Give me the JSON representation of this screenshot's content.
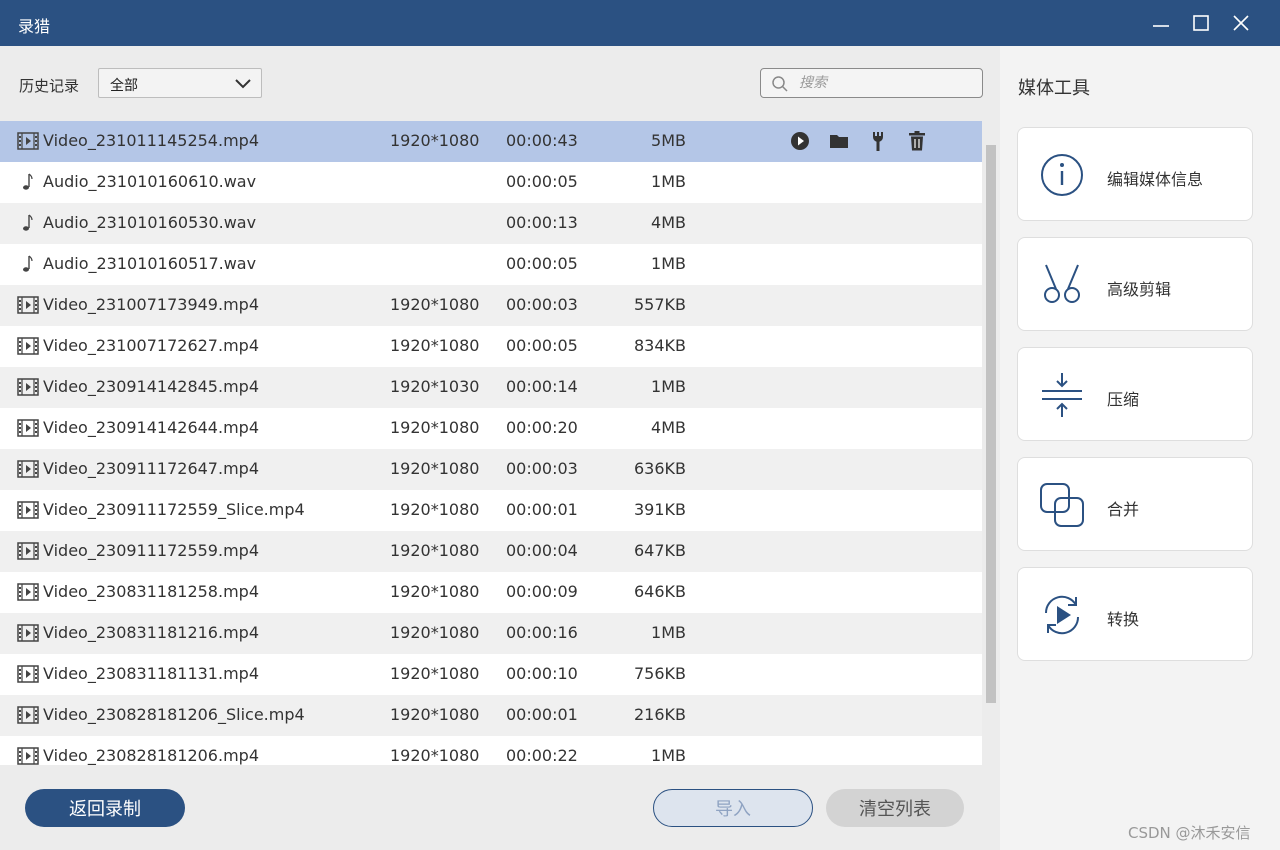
{
  "window": {
    "title": "录猎",
    "controls": [
      "minimize-icon",
      "maximize-icon",
      "close-icon"
    ]
  },
  "filter": {
    "history_label": "历史记录",
    "dropdown_value": "全部",
    "search_placeholder": "搜索"
  },
  "files": [
    {
      "type": "video",
      "name": "Video_231011145254.mp4",
      "resolution": "1920*1080",
      "duration": "00:00:43",
      "size": "5MB",
      "selected": true
    },
    {
      "type": "audio",
      "name": "Audio_231010160610.wav",
      "resolution": "",
      "duration": "00:00:05",
      "size": "1MB"
    },
    {
      "type": "audio",
      "name": "Audio_231010160530.wav",
      "resolution": "",
      "duration": "00:00:13",
      "size": "4MB"
    },
    {
      "type": "audio",
      "name": "Audio_231010160517.wav",
      "resolution": "",
      "duration": "00:00:05",
      "size": "1MB"
    },
    {
      "type": "video",
      "name": "Video_231007173949.mp4",
      "resolution": "1920*1080",
      "duration": "00:00:03",
      "size": "557KB"
    },
    {
      "type": "video",
      "name": "Video_231007172627.mp4",
      "resolution": "1920*1080",
      "duration": "00:00:05",
      "size": "834KB"
    },
    {
      "type": "video",
      "name": "Video_230914142845.mp4",
      "resolution": "1920*1030",
      "duration": "00:00:14",
      "size": "1MB"
    },
    {
      "type": "video",
      "name": "Video_230914142644.mp4",
      "resolution": "1920*1080",
      "duration": "00:00:20",
      "size": "4MB"
    },
    {
      "type": "video",
      "name": "Video_230911172647.mp4",
      "resolution": "1920*1080",
      "duration": "00:00:03",
      "size": "636KB"
    },
    {
      "type": "video",
      "name": "Video_230911172559_Slice.mp4",
      "resolution": "1920*1080",
      "duration": "00:00:01",
      "size": "391KB"
    },
    {
      "type": "video",
      "name": "Video_230911172559.mp4",
      "resolution": "1920*1080",
      "duration": "00:00:04",
      "size": "647KB"
    },
    {
      "type": "video",
      "name": "Video_230831181258.mp4",
      "resolution": "1920*1080",
      "duration": "00:00:09",
      "size": "646KB"
    },
    {
      "type": "video",
      "name": "Video_230831181216.mp4",
      "resolution": "1920*1080",
      "duration": "00:00:16",
      "size": "1MB"
    },
    {
      "type": "video",
      "name": "Video_230831181131.mp4",
      "resolution": "1920*1080",
      "duration": "00:00:10",
      "size": "756KB"
    },
    {
      "type": "video",
      "name": "Video_230828181206_Slice.mp4",
      "resolution": "1920*1080",
      "duration": "00:00:01",
      "size": "216KB"
    },
    {
      "type": "video",
      "name": "Video_230828181206.mp4",
      "resolution": "1920*1080",
      "duration": "00:00:22",
      "size": "1MB"
    }
  ],
  "row_actions": [
    "play-icon",
    "folder-icon",
    "wrench-icon",
    "trash-icon"
  ],
  "bottom": {
    "back_label": "返回录制",
    "import_label": "导入",
    "clear_label": "清空列表"
  },
  "tools": {
    "title": "媒体工具",
    "items": [
      {
        "label": "编辑媒体信息",
        "icon": "info-icon"
      },
      {
        "label": "高级剪辑",
        "icon": "scissors-icon"
      },
      {
        "label": "压缩",
        "icon": "compress-icon"
      },
      {
        "label": "合并",
        "icon": "merge-icon"
      },
      {
        "label": "转换",
        "icon": "convert-icon"
      }
    ]
  },
  "watermark": "CSDN @沐禾安信",
  "colors": {
    "primary": "#2b5182",
    "selected_row": "#b4c6e7",
    "striped_row": "#f0f0f0",
    "panel_bg": "#ececec"
  }
}
